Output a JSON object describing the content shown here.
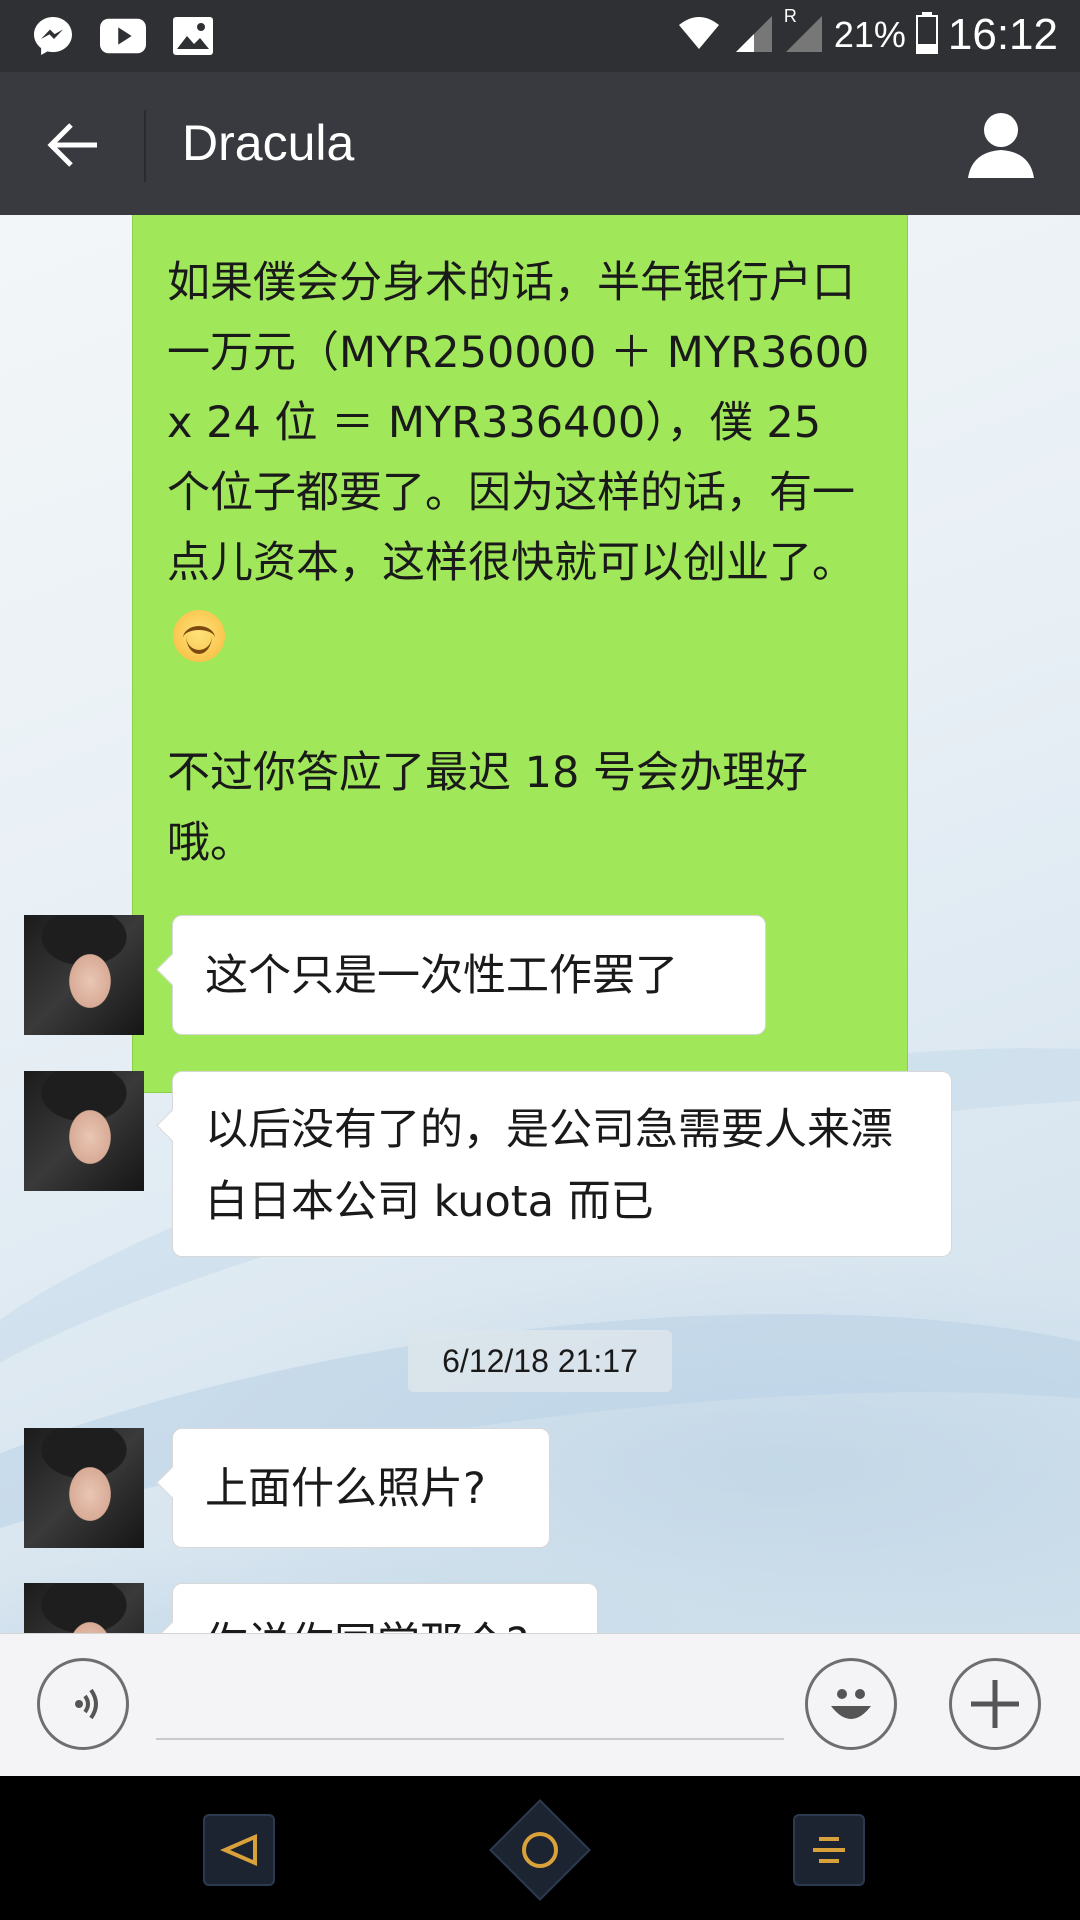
{
  "status_bar": {
    "battery_label": "21%",
    "time": "16:12",
    "left_icons": [
      "messenger-icon",
      "youtube-icon",
      "gallery-icon"
    ],
    "right_icons": [
      "wifi-icon",
      "signal-icon",
      "signal-roaming-icon",
      "battery-icon"
    ],
    "roaming_letter": "R"
  },
  "header": {
    "title": "Dracula",
    "back_icon": "arrow-left-icon",
    "profile_icon": "user-icon"
  },
  "messages": {
    "sent_1": {
      "paragraph_1": "如果僕会分身术的话，半年银行户口一万元（MYR250000 ＋ MYR3600 x 24 位 ＝ MYR336400），僕 25 个位子都要了。因为这样的话，有一点儿资本，这样很快就可以创业了。",
      "paragraph_2": "不过你答应了最迟 18 号会办理好哦。",
      "emoji": "smiling-face-icon"
    },
    "recv_1": "这个只是一次性工作罢了",
    "recv_2": "以后没有了的，是公司急需要人来漂白日本公司 kuota 而已",
    "timestamp": "6/12/18 21:17",
    "recv_3": "上面什么照片?",
    "recv_4_partial": "你说你同学那个?"
  },
  "input_bar": {
    "voice_icon": "voice-icon",
    "input_value": "",
    "emoji_icon": "emoji-icon",
    "plus_icon": "plus-icon"
  },
  "nav_bar": {
    "back_icon": "nav-back-icon",
    "home_icon": "nav-home-icon",
    "menu_icon": "nav-menu-icon"
  },
  "colors": {
    "sent_bubble": "#a0e75a",
    "header_bg": "#393a3f",
    "status_bg": "#2f3033",
    "nav_accent": "#d9a13a"
  }
}
